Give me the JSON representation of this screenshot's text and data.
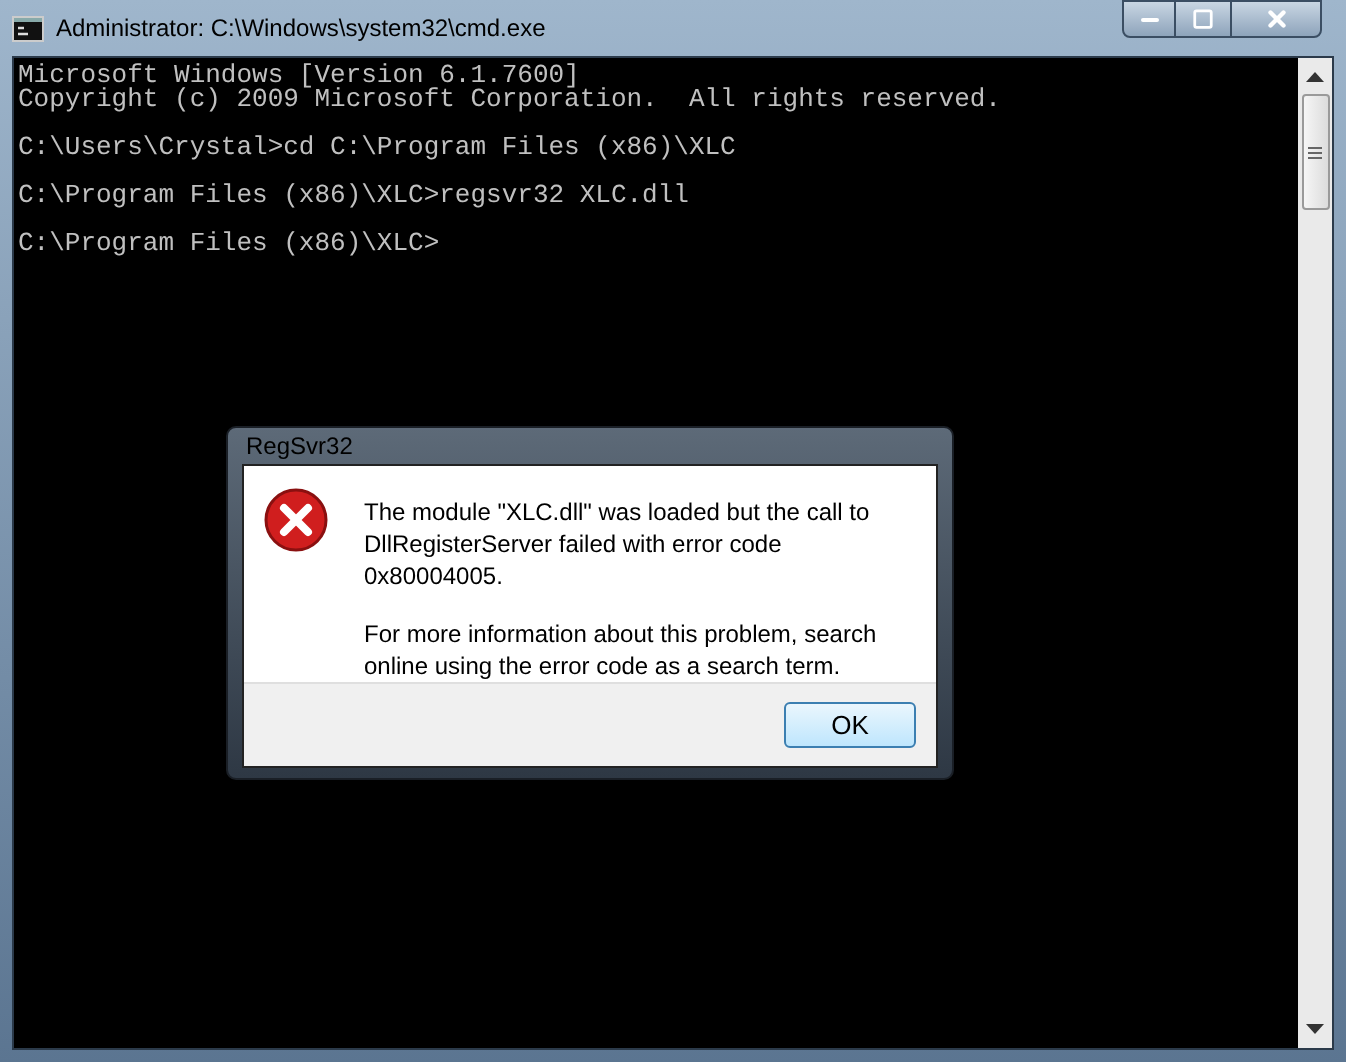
{
  "window": {
    "title": "Administrator: C:\\Windows\\system32\\cmd.exe"
  },
  "console": {
    "blocks": [
      [
        "Microsoft Windows [Version 6.1.7600]",
        "Copyright (c) 2009 Microsoft Corporation.  All rights reserved."
      ],
      [
        "C:\\Users\\Crystal>cd C:\\Program Files (x86)\\XLC"
      ],
      [
        "C:\\Program Files (x86)\\XLC>regsvr32 XLC.dll"
      ],
      [
        "C:\\Program Files (x86)\\XLC>"
      ]
    ]
  },
  "dialog": {
    "title": "RegSvr32",
    "paragraphs": [
      "The module \"XLC.dll\" was loaded but the call to DllRegisterServer failed with error code 0x80004005.",
      "For more information about this problem, search online using the error code as a search term."
    ],
    "buttons": [
      "OK"
    ]
  }
}
